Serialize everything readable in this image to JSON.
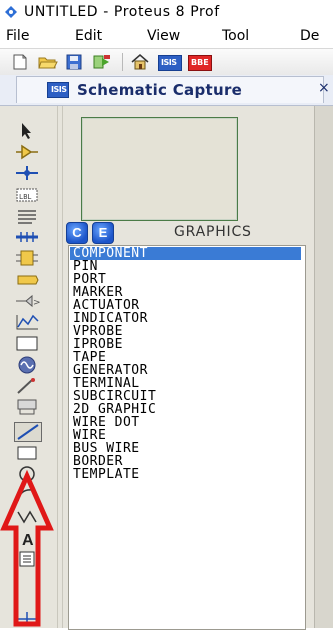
{
  "window": {
    "title": "UNTITLED - Proteus 8 Prof"
  },
  "menu": [
    "File",
    "Edit",
    "View",
    "Tool",
    "De"
  ],
  "toolbar": {
    "buttons": [
      "new-file",
      "open-file",
      "save",
      "import",
      "home",
      "schematic",
      "bom"
    ],
    "schematic_label": "ISIS",
    "bom_label": "BBE"
  },
  "tab": {
    "label": "Schematic Capture",
    "icon_text": "ISIS",
    "close": "×"
  },
  "selector": {
    "c_label": "C",
    "e_label": "E",
    "graphics_label": "GRAPHICS"
  },
  "list_items": [
    "COMPONENT",
    "PIN",
    "PORT",
    "MARKER",
    "ACTUATOR",
    "INDICATOR",
    "VPROBE",
    "IPROBE",
    "TAPE",
    "GENERATOR",
    "TERMINAL",
    "SUBCIRCUIT",
    "2D GRAPHIC",
    "WIRE DOT",
    "WIRE",
    "BUS WIRE",
    "BORDER",
    "TEMPLATE"
  ],
  "selected_item": "COMPONENT",
  "left_toolbar_icons": [
    "select-arrow-icon",
    "component-icon",
    "junction-dot-icon",
    "wire-label-icon",
    "text-script-icon",
    "bus-icon",
    "subcircuit-icon",
    "terminal-icon",
    "pin-icon",
    "graph-icon",
    "tape-recorder-icon",
    "generator-icon",
    "voltage-probe-icon",
    "current-probe-icon",
    "line-icon",
    "box-icon",
    "circle-icon",
    "arc-icon",
    "path-icon",
    "text-icon",
    "symbol-icon",
    "marker-icon"
  ],
  "colors": {
    "selected_bg": "#3a7bd5",
    "arrow": "#e01818",
    "tab_icon": "#2d5fc4"
  }
}
